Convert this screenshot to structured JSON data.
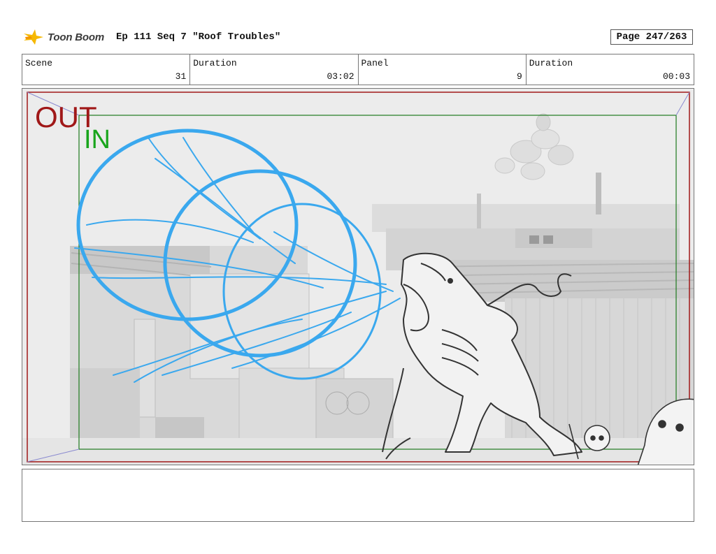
{
  "header": {
    "logo_text": "Toon Boom",
    "title": "Ep 111 Seq 7 \"Roof Troubles\"",
    "page": "Page 247/263"
  },
  "info": {
    "scene_label": "Scene",
    "scene_value": "31",
    "duration1_label": "Duration",
    "duration1_value": "03:02",
    "panel_label": "Panel",
    "panel_value": "9",
    "duration2_label": "Duration",
    "duration2_value": "00:03"
  },
  "frame": {
    "out_label": "OUT",
    "in_label": "IN",
    "out_color": "#a01818",
    "in_color": "#19a51c",
    "sketch_color": "#3aa8ee"
  },
  "notes": {
    "text": ""
  }
}
